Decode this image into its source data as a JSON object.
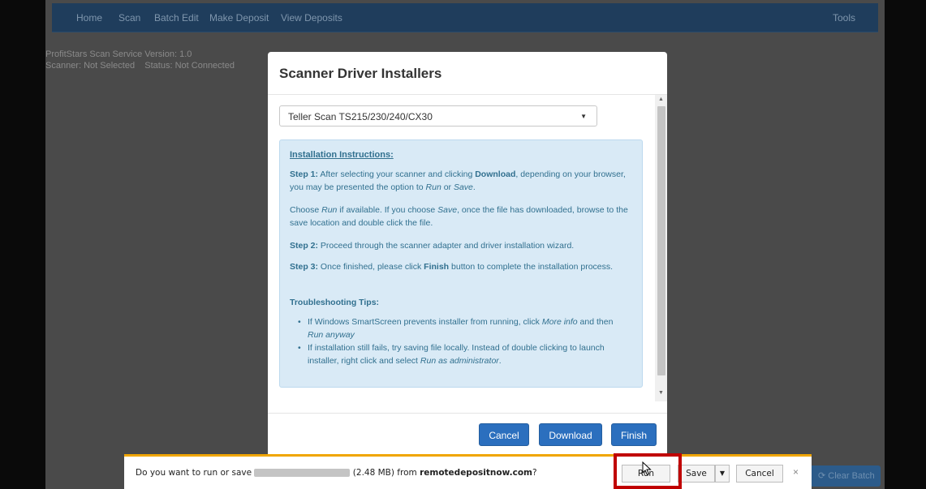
{
  "nav": {
    "items": [
      "Home",
      "Scan",
      "Batch Edit",
      "Make Deposit",
      "View Deposits"
    ],
    "right_item": "Tools"
  },
  "app_info": {
    "line1": "ProfitStars Scan Service Version: 1.0",
    "line2": "Scanner: Not Selected    Status: Not Connected"
  },
  "clear_batch_label": "Clear Batch",
  "modal": {
    "title": "Scanner Driver Installers",
    "select_value": "Teller Scan TS215/230/240/CX30",
    "instructions_title": "Installation Instructions:",
    "step1_label": "Step 1:",
    "step1_a": " After selecting your scanner and clicking ",
    "step1_download": "Download",
    "step1_b": ", depending on your browser, you may be presented the option to ",
    "step1_run": "Run",
    "step1_or": " or ",
    "step1_save": "Save",
    "step1_end": ".",
    "choose_a": "Choose ",
    "choose_run": "Run",
    "choose_b": " if available. If you choose ",
    "choose_save": "Save",
    "choose_c": ", once the file has downloaded, browse to the save location and double click the file.",
    "step2_label": "Step 2:",
    "step2_text": " Proceed through the scanner adapter and driver installation wizard.",
    "step3_label": "Step 3:",
    "step3_a": " Once finished, please click ",
    "step3_finish": "Finish",
    "step3_b": " button to complete the installation process.",
    "tips_title": "Troubleshooting Tips:",
    "tip1_a": "If Windows SmartScreen prevents installer from running, click ",
    "tip1_more": "More info",
    "tip1_b": " and then ",
    "tip1_run": "Run anyway",
    "tip2_a": "If installation still fails, try saving file locally. Instead of double clicking to launch installer, right click and select ",
    "tip2_admin": "Run as administrator",
    "tip2_end": ".",
    "cancel_label": "Cancel",
    "download_label": "Download",
    "finish_label": "Finish"
  },
  "download_bar": {
    "prefix": "Do you want to run or save ",
    "middle": " (2.48 MB) from ",
    "domain": "remotedepositnow.com",
    "suffix": "?",
    "run_label": "Run",
    "save_label": "Save",
    "cancel_label": "Cancel",
    "close_glyph": "×"
  },
  "colors": {
    "primary_button": "#2b6fbe",
    "info_bg": "#d9eaf6",
    "info_text": "#31708f",
    "highlight": "#c00000",
    "download_bar_accent": "#f0a500"
  },
  "icons": [
    "chevron-down-icon",
    "close-icon",
    "mouse-cursor-icon",
    "refresh-icon"
  ]
}
